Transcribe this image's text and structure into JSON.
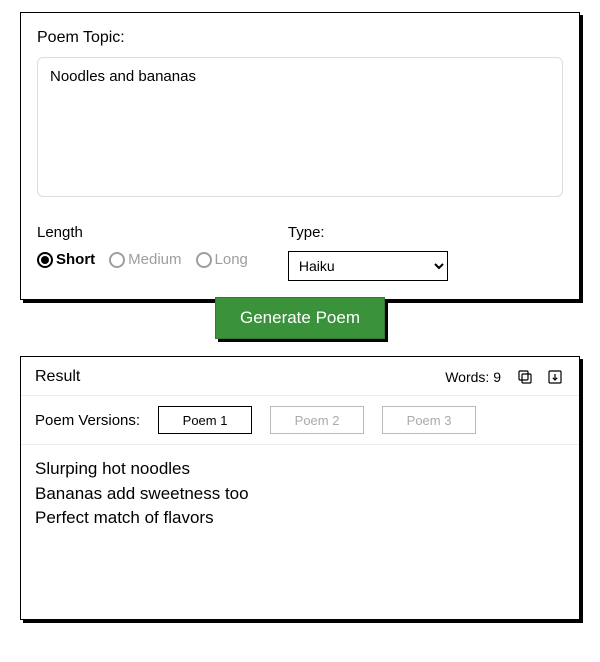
{
  "topic": {
    "label": "Poem Topic:",
    "value": "Noodles and bananas"
  },
  "length": {
    "label": "Length",
    "options": [
      "Short",
      "Medium",
      "Long"
    ],
    "selected": "Short"
  },
  "type": {
    "label": "Type:",
    "options": [
      "Haiku"
    ],
    "selected": "Haiku"
  },
  "generate_label": "Generate Poem",
  "result": {
    "title": "Result",
    "words_label": "Words:",
    "words_count": 9,
    "versions_label": "Poem Versions:",
    "versions": [
      "Poem 1",
      "Poem 2",
      "Poem 3"
    ],
    "active_version": "Poem 1",
    "poem_text": "Slurping hot noodles\nBananas add sweetness too\nPerfect match of flavors"
  }
}
